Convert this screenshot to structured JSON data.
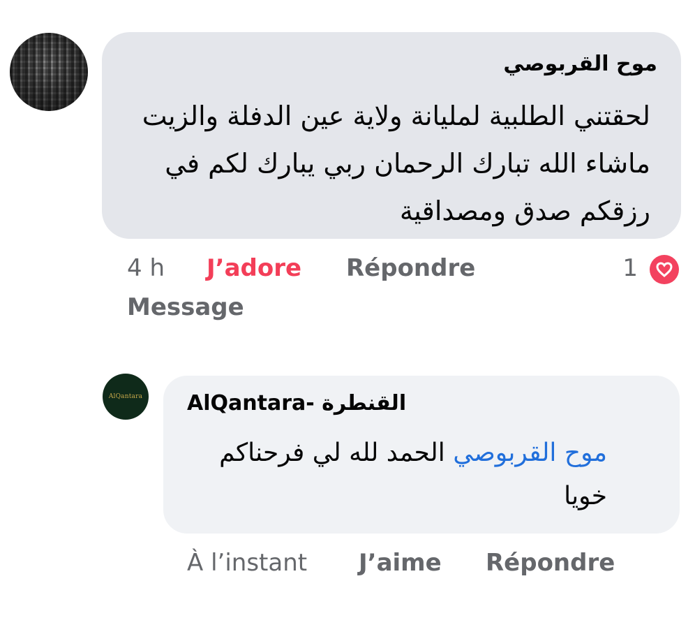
{
  "comment": {
    "author": "موح القربوصي",
    "text": "لحقتني الطلبية لمليانة ولاية عين الدفلة والزيت ماشاء الله تبارك الرحمان ربي يبارك لكم في رزقكم صدق ومصداقية",
    "time": "4 h",
    "love_label": "J’adore",
    "reply_label": "Répondre",
    "message_label": "Message",
    "reaction_count": "1",
    "reaction_icon": "heart-icon"
  },
  "reply": {
    "author": "AlQantara- القنطرة",
    "avatar_text": "AlQantara",
    "mention": "موح القربوصي",
    "text": "الحمد لله لي فرحناكم خويا",
    "time": "À l’instant",
    "like_label": "J’aime",
    "reply_label": "Répondre"
  },
  "colors": {
    "love": "#f33e58",
    "mention": "#216fdb",
    "meta": "#65676b",
    "bubble_main": "#e4e6eb",
    "bubble_reply": "#f0f2f5"
  }
}
